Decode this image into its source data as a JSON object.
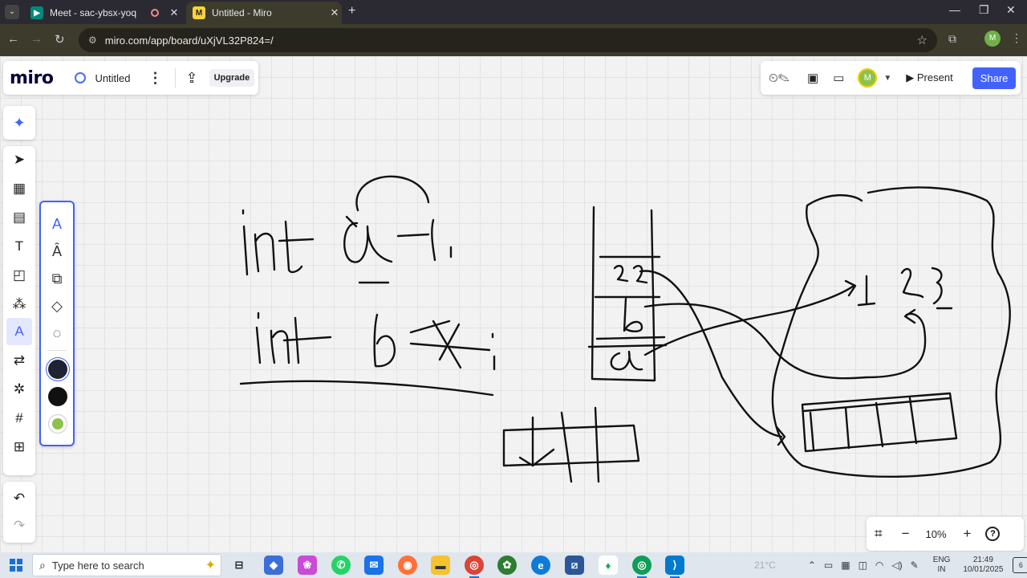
{
  "browser": {
    "tabs": [
      {
        "title": "Meet - sac-ybsx-yoq",
        "favicon": "google-meet-icon",
        "recording": true
      },
      {
        "title": "Untitled - Miro",
        "favicon": "miro-icon",
        "active": true
      }
    ],
    "url": "miro.com/app/board/uXjVL32P824=/",
    "profile_initial": "M"
  },
  "miro": {
    "logo": "miro",
    "board_title": "Untitled",
    "upgrade_label": "Upgrade",
    "avatar_initial": "M",
    "present_label": "Present",
    "share_label": "Share",
    "accent_color": "#4262ff"
  },
  "toolbar": {
    "tools": [
      "select-icon",
      "templates-icon",
      "comment-icon",
      "text-icon",
      "sticky-note-icon",
      "shapes-icon",
      "pen-icon",
      "diagram-icon",
      "mind-map-icon",
      "frame-icon",
      "add-icon"
    ],
    "selected": "pen-icon"
  },
  "pen_panel": {
    "tools": [
      "pen-icon",
      "highlighter-icon",
      "smart-draw-icon",
      "eraser-icon",
      "lasso-icon"
    ],
    "colors": [
      "#1f2333",
      "#111111",
      "#8bc34a"
    ]
  },
  "zoom": {
    "level": "10%"
  },
  "taskbar": {
    "search_placeholder": "Type here to search",
    "weather": "21°C",
    "lang_line1": "ENG",
    "lang_line2": "IN",
    "time": "21:49",
    "date": "10/01/2025",
    "notifications": "6"
  }
}
